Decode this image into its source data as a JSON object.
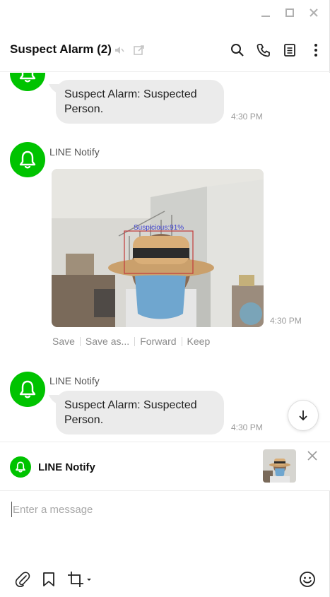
{
  "window": {
    "controls": [
      "minimize",
      "maximize",
      "close"
    ]
  },
  "header": {
    "title": "Suspect Alarm (2)",
    "icons": [
      "speaker-muted-icon",
      "external-link-icon"
    ],
    "actions": [
      "search-icon",
      "phone-icon",
      "notes-icon",
      "more-icon"
    ]
  },
  "messages": [
    {
      "type": "text",
      "text_lines": [
        "Suspect Alarm: Suspected",
        "Person."
      ],
      "time": "4:30 PM"
    },
    {
      "type": "image",
      "sender": "LINE Notify",
      "time": "4:30 PM",
      "detection_label": "Suspicious:91%",
      "image_actions": [
        "Save",
        "Save as...",
        "Forward",
        "Keep"
      ]
    },
    {
      "type": "text",
      "sender": "LINE Notify",
      "text_lines": [
        "Suspect Alarm: Suspected",
        "Person."
      ],
      "time": "4:30 PM"
    }
  ],
  "preview": {
    "name": "LINE Notify"
  },
  "input": {
    "placeholder": "Enter a message",
    "value": ""
  },
  "toolbar": [
    "paperclip-icon",
    "bookmark-icon",
    "crop-icon",
    "emoji-icon"
  ],
  "colors": {
    "brand_green": "#00c300",
    "bubble": "#ebebeb",
    "detection_box": "#c23a3a",
    "detection_text": "#3c3fd0"
  }
}
